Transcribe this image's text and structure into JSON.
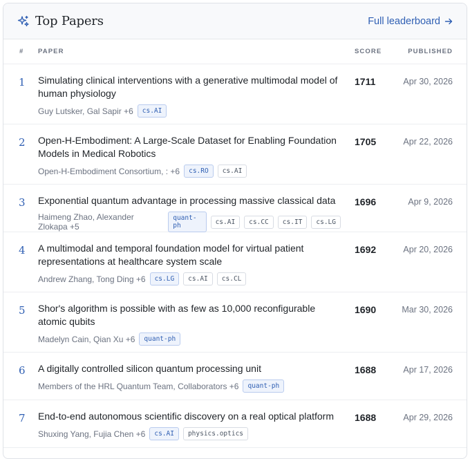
{
  "header": {
    "title": "Top Papers",
    "link_label": "Full leaderboard",
    "link_arrow": "→"
  },
  "columns": {
    "rank": "#",
    "paper": "PAPER",
    "score": "SCORE",
    "published": "PUBLISHED"
  },
  "papers": [
    {
      "rank": "1",
      "title": "Simulating clinical interventions with a generative multimodal model of human physiology",
      "authors": "Guy Lutsker, Gal Sapir +6",
      "tags": [
        "cs.AI"
      ],
      "score": "1711",
      "date": "Apr 30, 2026"
    },
    {
      "rank": "2",
      "title": "Open-H-Embodiment: A Large-Scale Dataset for Enabling Foundation Models in Medical Robotics",
      "authors": "Open-H-Embodiment Consortium, : +6",
      "tags": [
        "cs.RO",
        "cs.AI"
      ],
      "score": "1705",
      "date": "Apr 22, 2026"
    },
    {
      "rank": "3",
      "title": "Exponential quantum advantage in processing massive classical data",
      "authors": "Haimeng Zhao, Alexander Zlokapa +5",
      "tags": [
        "quant-ph",
        "cs.AI",
        "cs.CC",
        "cs.IT",
        "cs.LG"
      ],
      "score": "1696",
      "date": "Apr 9, 2026"
    },
    {
      "rank": "4",
      "title": "A multimodal and temporal foundation model for virtual patient representations at healthcare system scale",
      "authors": "Andrew Zhang, Tong Ding +6",
      "tags": [
        "cs.LG",
        "cs.AI",
        "cs.CL"
      ],
      "score": "1692",
      "date": "Apr 20, 2026"
    },
    {
      "rank": "5",
      "title": "Shor's algorithm is possible with as few as 10,000 reconfigurable atomic qubits",
      "authors": "Madelyn Cain, Qian Xu +6",
      "tags": [
        "quant-ph"
      ],
      "score": "1690",
      "date": "Mar 30, 2026"
    },
    {
      "rank": "6",
      "title": "A digitally controlled silicon quantum processing unit",
      "authors": "Members of the HRL Quantum Team, Collaborators +6",
      "tags": [
        "quant-ph"
      ],
      "score": "1688",
      "date": "Apr 17, 2026"
    },
    {
      "rank": "7",
      "title": "End-to-end autonomous scientific discovery on a real optical platform",
      "authors": "Shuxing Yang, Fujia Chen +6",
      "tags": [
        "cs.AI",
        "physics.optics"
      ],
      "score": "1688",
      "date": "Apr 29, 2026"
    }
  ],
  "colors": {
    "accent": "#2f5fb3",
    "border": "#dfe2e7",
    "header_bg": "#f8f9fb"
  }
}
